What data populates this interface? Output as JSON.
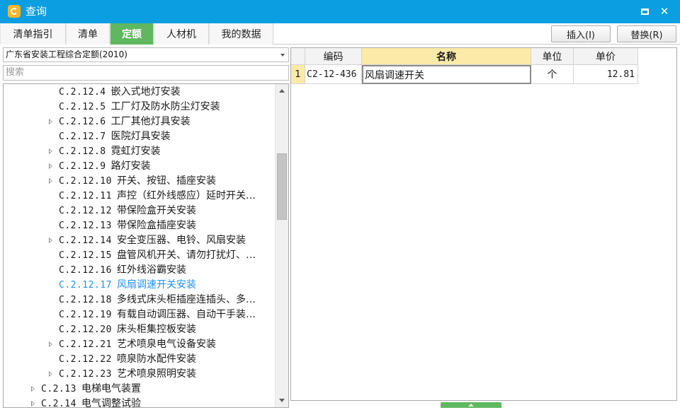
{
  "window": {
    "title": "查询"
  },
  "tabs": [
    {
      "label": "清单指引",
      "active": false
    },
    {
      "label": "清单",
      "active": false
    },
    {
      "label": "定额",
      "active": true
    },
    {
      "label": "人材机",
      "active": false
    },
    {
      "label": "我的数据",
      "active": false
    }
  ],
  "toolbar": {
    "insert_label": "插入(I)",
    "replace_label": "替换(R)"
  },
  "left": {
    "quota_selected": "广东省安装工程综合定额(2010)",
    "search_placeholder": "搜索"
  },
  "tree": [
    {
      "code": "C.2.12.4",
      "name": "嵌入式地灯安装",
      "level": 3,
      "expandable": false,
      "selected": false
    },
    {
      "code": "C.2.12.5",
      "name": "工厂灯及防水防尘灯安装",
      "level": 3,
      "expandable": false,
      "selected": false
    },
    {
      "code": "C.2.12.6",
      "name": "工厂其他灯具安装",
      "level": 3,
      "expandable": true,
      "selected": false
    },
    {
      "code": "C.2.12.7",
      "name": "医院灯具安装",
      "level": 3,
      "expandable": false,
      "selected": false
    },
    {
      "code": "C.2.12.8",
      "name": "霓虹灯安装",
      "level": 3,
      "expandable": true,
      "selected": false
    },
    {
      "code": "C.2.12.9",
      "name": "路灯安装",
      "level": 3,
      "expandable": true,
      "selected": false
    },
    {
      "code": "C.2.12.10",
      "name": "开关、按钮、插座安装",
      "level": 3,
      "expandable": true,
      "selected": false
    },
    {
      "code": "C.2.12.11",
      "name": "声控（红外线感应）延时开关…",
      "level": 3,
      "expandable": false,
      "selected": false
    },
    {
      "code": "C.2.12.12",
      "name": "带保险盒开关安装",
      "level": 3,
      "expandable": false,
      "selected": false
    },
    {
      "code": "C.2.12.13",
      "name": "带保险盒插座安装",
      "level": 3,
      "expandable": false,
      "selected": false
    },
    {
      "code": "C.2.12.14",
      "name": "安全变压器、电铃、风扇安装",
      "level": 3,
      "expandable": true,
      "selected": false
    },
    {
      "code": "C.2.12.15",
      "name": "盘管风机开关、请勿打扰灯、…",
      "level": 3,
      "expandable": false,
      "selected": false
    },
    {
      "code": "C.2.12.16",
      "name": "红外线浴霸安装",
      "level": 3,
      "expandable": false,
      "selected": false
    },
    {
      "code": "C.2.12.17",
      "name": "风扇调速开关安装",
      "level": 3,
      "expandable": false,
      "selected": true
    },
    {
      "code": "C.2.12.18",
      "name": "多线式床头柜插座连插头、多…",
      "level": 3,
      "expandable": false,
      "selected": false
    },
    {
      "code": "C.2.12.19",
      "name": "有载自动调压器、自动干手装…",
      "level": 3,
      "expandable": false,
      "selected": false
    },
    {
      "code": "C.2.12.20",
      "name": "床头柜集控板安装",
      "level": 3,
      "expandable": false,
      "selected": false
    },
    {
      "code": "C.2.12.21",
      "name": "艺术喷泉电气设备安装",
      "level": 3,
      "expandable": true,
      "selected": false
    },
    {
      "code": "C.2.12.22",
      "name": "喷泉防水配件安装",
      "level": 3,
      "expandable": false,
      "selected": false
    },
    {
      "code": "C.2.12.23",
      "name": "艺术喷泉照明安装",
      "level": 3,
      "expandable": true,
      "selected": false
    },
    {
      "code": "C.2.13",
      "name": "电梯电气装置",
      "level": 2,
      "expandable": true,
      "selected": false
    },
    {
      "code": "C.2.14",
      "name": "电气调整试验",
      "level": 2,
      "expandable": true,
      "selected": false
    }
  ],
  "grid": {
    "columns": [
      {
        "label": "编码",
        "highlighted": false
      },
      {
        "label": "名称",
        "highlighted": true
      },
      {
        "label": "单位",
        "highlighted": false
      },
      {
        "label": "单价",
        "highlighted": false
      }
    ],
    "rows": [
      {
        "index": "1",
        "code": "C2-12-436",
        "name": "风扇调速开关",
        "unit": "个",
        "price": "12.81"
      }
    ]
  },
  "colors": {
    "titlebar": "#0b9ee0",
    "active_tab": "#5fb85f",
    "selected_tree": "#1e90ff",
    "header_highlight": "#fbeaa8"
  }
}
